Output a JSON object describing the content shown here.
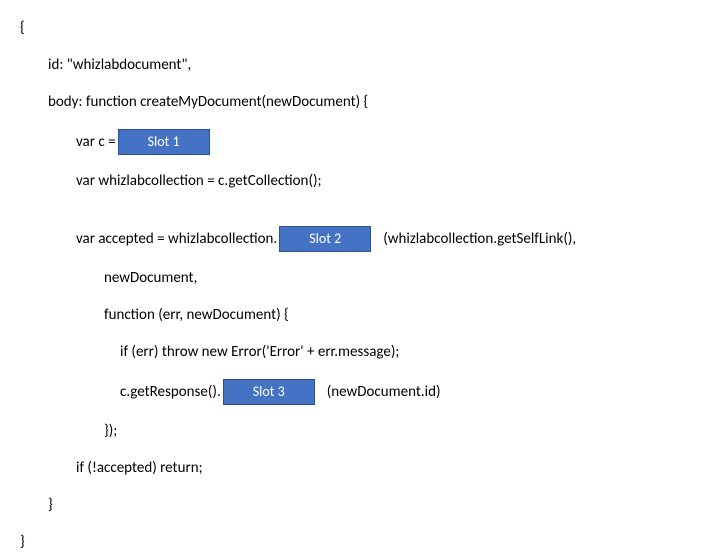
{
  "code": {
    "l1": "{",
    "l2": "id: \"whizlabdocument\",",
    "l3": "body: function createMyDocument(newDocument) {",
    "l4a": "var c =  ",
    "slot1": "Slot 1",
    "l5": "var whizlabcollection = c.getCollection();",
    "l6a": "var accepted = whizlabcollection.",
    "slot2": "Slot 2",
    "l6b": "(whizlabcollection.getSelfLink(),",
    "l7": "newDocument,",
    "l8": "function (err, newDocument) {",
    "l9": "if (err) throw new Error('Error' + err.message);",
    "l10a": "c.getResponse().",
    "slot3": "Slot 3",
    "l10b": "(newDocument.id)",
    "l11": "});",
    "l12": "if (!accepted) return;",
    "l13": "}",
    "l14": "}"
  }
}
